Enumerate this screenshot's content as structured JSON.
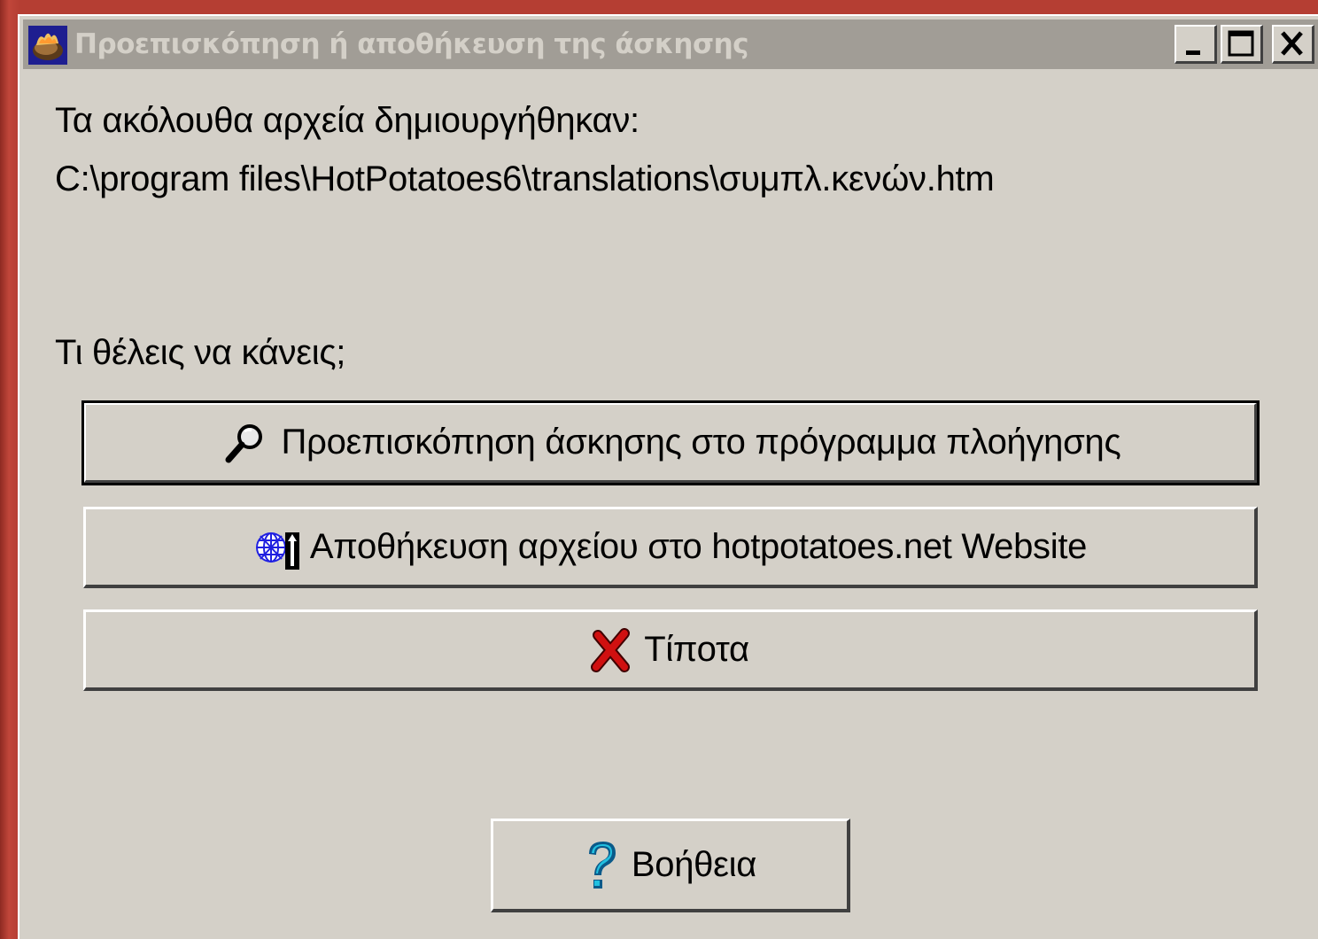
{
  "window": {
    "title": "Προεπισκόπηση ή αποθήκευση της άσκησης",
    "icon": "hot-potatoes-app-icon",
    "controls": {
      "minimize_icon": "minimize-icon",
      "maximize_icon": "maximize-icon",
      "close_icon": "close-icon"
    }
  },
  "content": {
    "files_created_label": "Τα ακόλουθα αρχεία δημιουργήθηκαν:",
    "file_path": "C:\\program files\\HotPotatoes6\\translations\\συμπλ.κενών.htm",
    "question": "Τι θέλεις να κάνεις;"
  },
  "actions": {
    "preview": {
      "label": "Προεπισκόπηση άσκησης στο πρόγραμμα πλοήγησης",
      "icon": "magnifier-icon"
    },
    "upload": {
      "label": "Αποθήκευση αρχείου στο hotpotatoes.net Website",
      "icon": "web-upload-icon"
    },
    "nothing": {
      "label": "Τίποτα",
      "icon": "red-x-icon"
    },
    "help": {
      "label": "Βοήθεια",
      "icon": "question-mark-icon"
    }
  },
  "colors": {
    "dialog_bg": "#d4d0c8",
    "titlebar_inactive": "#a19d96",
    "desktop": "#b03a2e"
  }
}
